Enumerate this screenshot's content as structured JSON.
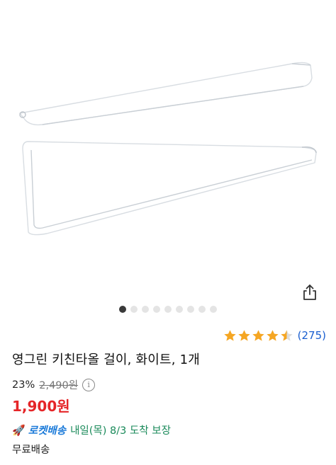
{
  "product": {
    "title": "영그린 키친타올 걸이, 화이트, 1개",
    "rating": 4.5,
    "review_count": "(275)",
    "discount": "23%",
    "original_price": "2,490원",
    "sale_price": "1,900원",
    "info_icon": "i"
  },
  "gallery": {
    "total_images": 9,
    "current_index": 0
  },
  "delivery": {
    "badge_label": "로켓배송",
    "badge_icon": "rocket-icon",
    "eta": "내일(목) 8/3 도착 보장",
    "shipping": "무료배송"
  },
  "colors": {
    "price_red": "#e52528",
    "star_gold": "#f5a623",
    "link_blue": "#1a5fd0",
    "delivery_green": "#1a8a5a",
    "rocket_blue": "#1a7ad9"
  }
}
